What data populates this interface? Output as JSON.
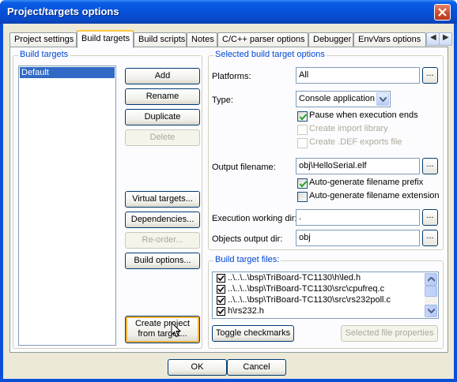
{
  "window": {
    "title": "Project/targets options"
  },
  "tabs": [
    {
      "label": "Project settings"
    },
    {
      "label": "Build targets"
    },
    {
      "label": "Build scripts"
    },
    {
      "label": "Notes"
    },
    {
      "label": "C/C++ parser options"
    },
    {
      "label": "Debugger"
    },
    {
      "label": "EnvVars options"
    }
  ],
  "build_targets": {
    "group_label": "Build targets",
    "items": [
      "Default"
    ],
    "buttons": {
      "add": "Add",
      "rename": "Rename",
      "duplicate": "Duplicate",
      "delete": "Delete",
      "virtual_targets": "Virtual targets...",
      "dependencies": "Dependencies...",
      "reorder": "Re-order...",
      "build_options": "Build options...",
      "create_project": "Create project from target..."
    }
  },
  "selected_options": {
    "group_label": "Selected build target options",
    "platforms_label": "Platforms:",
    "platforms_value": "All",
    "type_label": "Type:",
    "type_value": "Console application",
    "pause_label": "Pause when execution ends",
    "pause_checked": true,
    "import_label": "Create import library",
    "def_label": "Create .DEF exports file",
    "output_label": "Output filename:",
    "output_value": "obj\\HelloSerial.elf",
    "autoprefix_label": "Auto-generate filename prefix",
    "autoprefix_checked": true,
    "autoext_label": "Auto-generate filename extension",
    "autoext_checked": false,
    "workdir_label": "Execution working dir:",
    "workdir_value": ".",
    "objdir_label": "Objects output dir:",
    "objdir_value": "obj",
    "ellipsis": "..."
  },
  "build_files": {
    "group_label": "Build target files:",
    "files": [
      {
        "name": "..\\..\\..\\bsp\\TriBoard-TC1130\\h\\led.h",
        "checked": true
      },
      {
        "name": "..\\..\\..\\bsp\\TriBoard-TC1130\\src\\cpufreq.c",
        "checked": true
      },
      {
        "name": "..\\..\\..\\bsp\\TriBoard-TC1130\\src\\rs232poll.c",
        "checked": true
      },
      {
        "name": "h\\rs232.h",
        "checked": true
      }
    ],
    "toggle_label": "Toggle checkmarks",
    "properties_label": "Selected file properties"
  },
  "footer": {
    "ok_label": "OK",
    "cancel_label": "Cancel"
  }
}
